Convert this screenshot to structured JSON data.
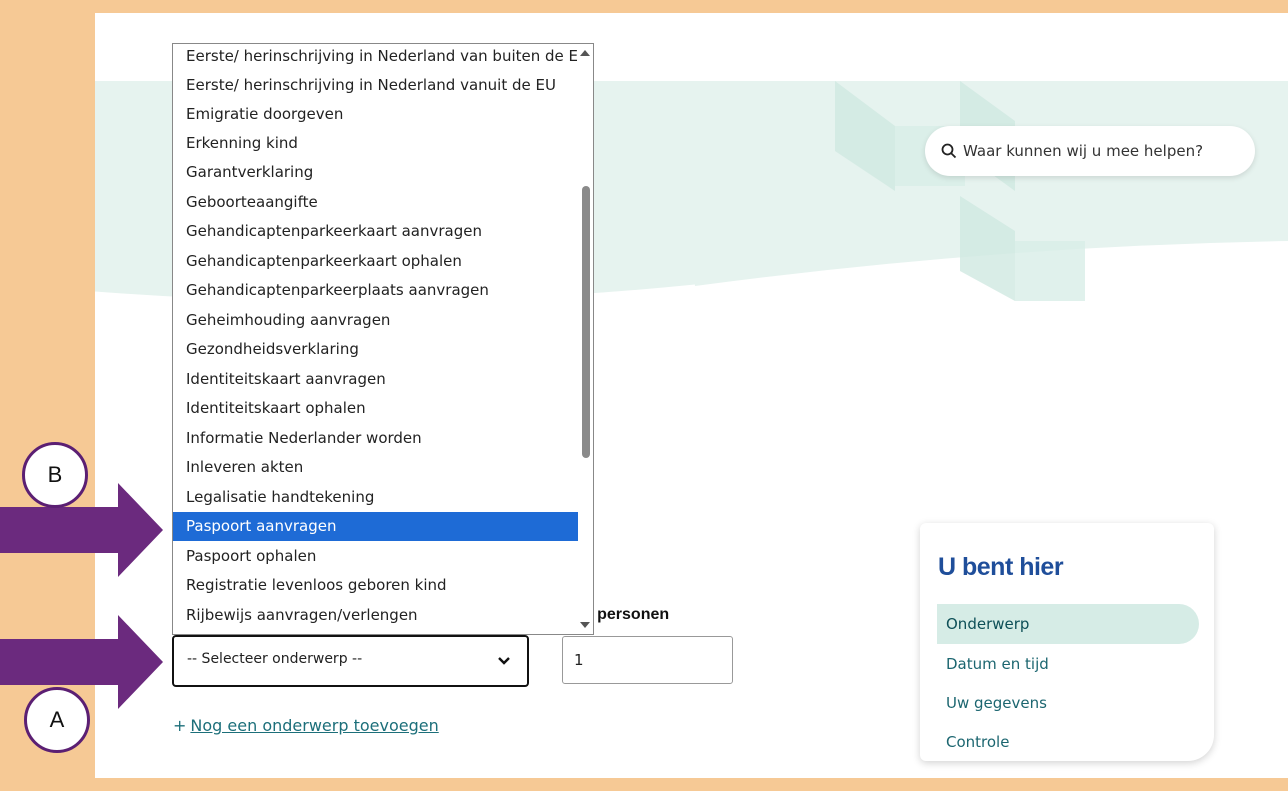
{
  "search": {
    "placeholder": "Waar kunnen wij u mee helpen?"
  },
  "breadcrumb_panel": {
    "title": "U bent hier",
    "steps": [
      "Onderwerp",
      "Datum en tijd",
      "Uw gegevens",
      "Controle"
    ],
    "active_step": "Onderwerp"
  },
  "form": {
    "subject_select_value": "-- Selecteer onderwerp --",
    "count_label": "tal personen",
    "count_value": "1",
    "add_subject_plus": "+",
    "add_subject_label": "Nog een onderwerp toevoegen"
  },
  "dropdown": {
    "options": [
      "Eerste/ herinschrijving in Nederland van buiten de EU",
      "Eerste/ herinschrijving in Nederland vanuit de EU",
      "Emigratie doorgeven",
      "Erkenning kind",
      "Garantverklaring",
      "Geboorteaangifte",
      "Gehandicaptenparkeerkaart aanvragen",
      "Gehandicaptenparkeerkaart ophalen",
      "Gehandicaptenparkeerplaats aanvragen",
      "Geheimhouding aanvragen",
      "Gezondheidsverklaring",
      "Identiteitskaart aanvragen",
      "Identiteitskaart ophalen",
      "Informatie Nederlander worden",
      "Inleveren akten",
      "Legalisatie handtekening",
      "Paspoort aanvragen",
      "Paspoort ophalen",
      "Registratie levenloos geboren kind",
      "Rijbewijs aanvragen/verlengen"
    ],
    "selected": "Paspoort aanvragen"
  },
  "annotations": {
    "label_a": "A",
    "label_b": "B"
  },
  "colors": {
    "frame": "#f6c995",
    "accent_teal": "#1c6f7a",
    "selected_blue": "#1e6bd6",
    "annotation_purple": "#6b2a7e",
    "title_blue": "#1f4e9a"
  }
}
